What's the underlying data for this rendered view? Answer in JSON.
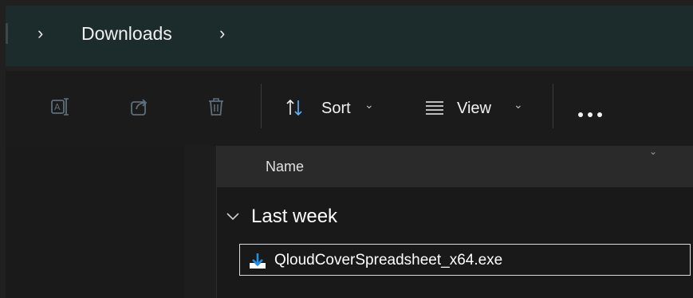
{
  "breadcrumb": {
    "items": [
      "Downloads"
    ]
  },
  "toolbar": {
    "sort_label": "Sort",
    "view_label": "View"
  },
  "file_list": {
    "columns": [
      "Name"
    ],
    "groups": [
      {
        "title": "Last week",
        "files": [
          {
            "name": "QloudCoverSpreadsheet_x64.exe"
          }
        ]
      }
    ]
  },
  "icons": {
    "chevron_right": "chevron-right-icon",
    "rename": "rename-icon",
    "share": "share-icon",
    "delete": "delete-icon",
    "sort": "sort-icon",
    "view": "view-icon",
    "more": "more-options-icon",
    "file": "installer-file-icon"
  },
  "colors": {
    "address_bar_bg": "#1c2b2b",
    "window_bg": "#191919",
    "header_bg": "#2a2a2a",
    "download_icon_blue": "#1e90e8",
    "selection_border": "#dcdcdc"
  }
}
